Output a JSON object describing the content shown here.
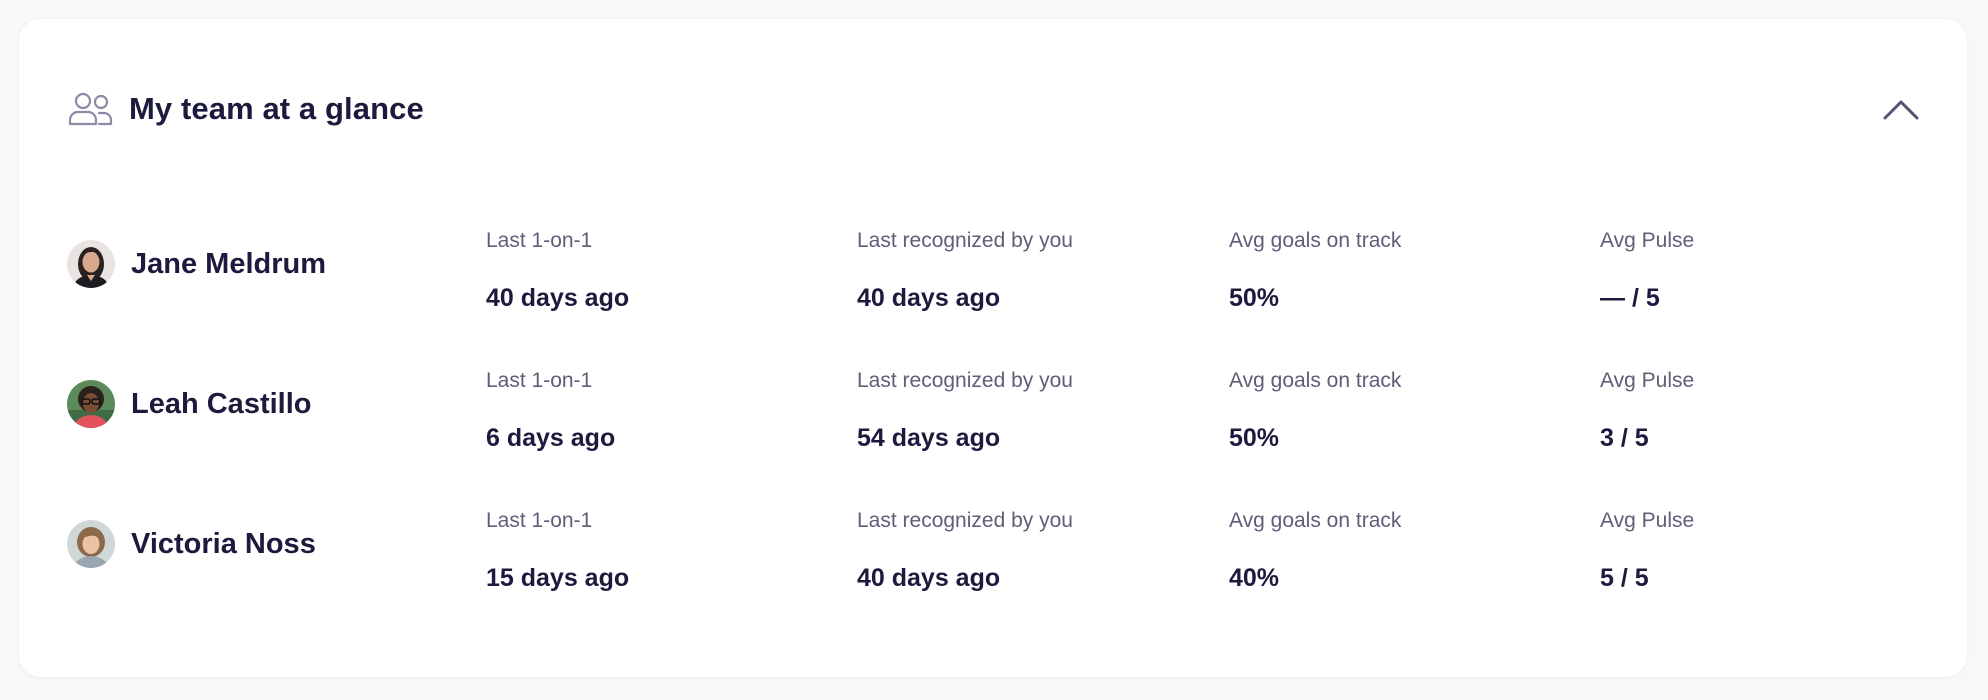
{
  "header": {
    "icon": "team-people-icon",
    "title": "My team at a glance",
    "collapse_icon": "chevron-up-icon"
  },
  "columns": {
    "last_one_on_one": "Last 1-on-1",
    "last_recognized": "Last recognized by you",
    "avg_goals": "Avg goals on track",
    "avg_pulse": "Avg Pulse"
  },
  "team": [
    {
      "name": "Jane Meldrum",
      "avatar": "avatar-photo",
      "last_one_on_one": "40 days ago",
      "last_recognized": "40 days ago",
      "avg_goals": "50%",
      "avg_pulse": "— / 5"
    },
    {
      "name": "Leah Castillo",
      "avatar": "avatar-photo",
      "last_one_on_one": "6 days ago",
      "last_recognized": "54 days ago",
      "avg_goals": "50%",
      "avg_pulse": "3 / 5"
    },
    {
      "name": "Victoria Noss",
      "avatar": "avatar-photo",
      "last_one_on_one": "15 days ago",
      "last_recognized": "40 days ago",
      "avg_goals": "40%",
      "avg_pulse": "5 / 5"
    }
  ],
  "colors": {
    "background": "#faf8f7",
    "card": "#ffffff",
    "text_primary": "#1c1a3d",
    "text_secondary": "#615d78",
    "icon_muted": "#8e8aa5"
  }
}
